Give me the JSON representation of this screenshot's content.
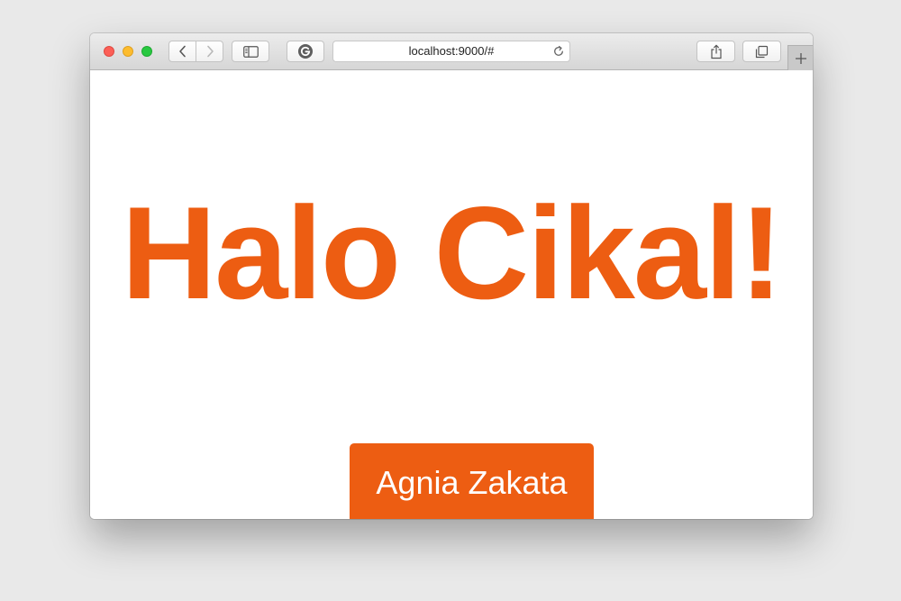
{
  "browser": {
    "url": "localhost:9000/#",
    "icons": {
      "close": "red-traffic-light",
      "minimize": "yellow-traffic-light",
      "zoom": "green-traffic-light",
      "back": "chevron-left-icon",
      "forward": "chevron-right-icon",
      "sidebar": "sidebar-icon",
      "extension": "grammarly-icon",
      "reload": "reload-icon",
      "share": "share-icon",
      "tabs": "tabs-overview-icon",
      "new_tab": "plus-icon"
    }
  },
  "page": {
    "headline": "Halo Cikal!",
    "button_label": "Agnia Zakata"
  },
  "colors": {
    "accent": "#ed5d12",
    "page_background": "#ffffff",
    "desktop_background": "#e9e9e9"
  }
}
